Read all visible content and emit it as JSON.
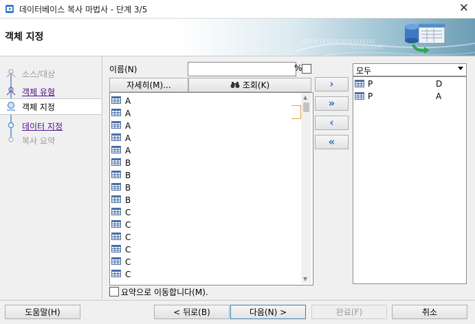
{
  "window": {
    "title": "데이터베이스 복사 마법사 - 단계 3/5",
    "close_glyph": "✕"
  },
  "header": {
    "title": "객체 지정",
    "binary_1": "0101010101010101010101",
    "binary_2": "0101010101"
  },
  "steps": [
    {
      "label": "소스/대상",
      "state": "done"
    },
    {
      "label": "객체 유형",
      "state": "link"
    },
    {
      "label": "객체 지정",
      "state": "active"
    },
    {
      "label": "데이터 지정",
      "state": "link"
    },
    {
      "label": "복사 요약",
      "state": "future"
    }
  ],
  "filter": {
    "name_label": "이름(N)",
    "name_value": "",
    "percent_label": "%",
    "percent_checked": false,
    "details_button": "자세히(M)...",
    "search_button": "조회(K)",
    "search_icon": "binoculars-icon"
  },
  "available_items": [
    "A",
    "A",
    "A",
    "A",
    "A",
    "B",
    "B",
    "B",
    "B",
    "C",
    "C",
    "C",
    "C",
    "C",
    "C"
  ],
  "move_buttons": [
    {
      "glyph": "›",
      "action": "move-selected-right"
    },
    {
      "glyph": "»",
      "action": "move-all-right"
    },
    {
      "glyph": "‹",
      "action": "move-selected-left"
    },
    {
      "glyph": "«",
      "action": "move-all-left"
    }
  ],
  "selected": {
    "filter_value": "모두",
    "items": [
      {
        "name": "P",
        "type": "D"
      },
      {
        "name": "P",
        "type": "A"
      }
    ]
  },
  "summary_checkbox": {
    "label": "요약으로 이동합니다(M).",
    "checked": false
  },
  "buttons": {
    "help": "도움말(H)",
    "back": "< 뒤로(B)",
    "next": "다음(N) >",
    "finish": "완료(F)",
    "cancel": "취소"
  },
  "colors": {
    "link": "#4b0d8a",
    "accent_blue": "#2b6cc4",
    "focus_orange": "#e8a33a"
  }
}
